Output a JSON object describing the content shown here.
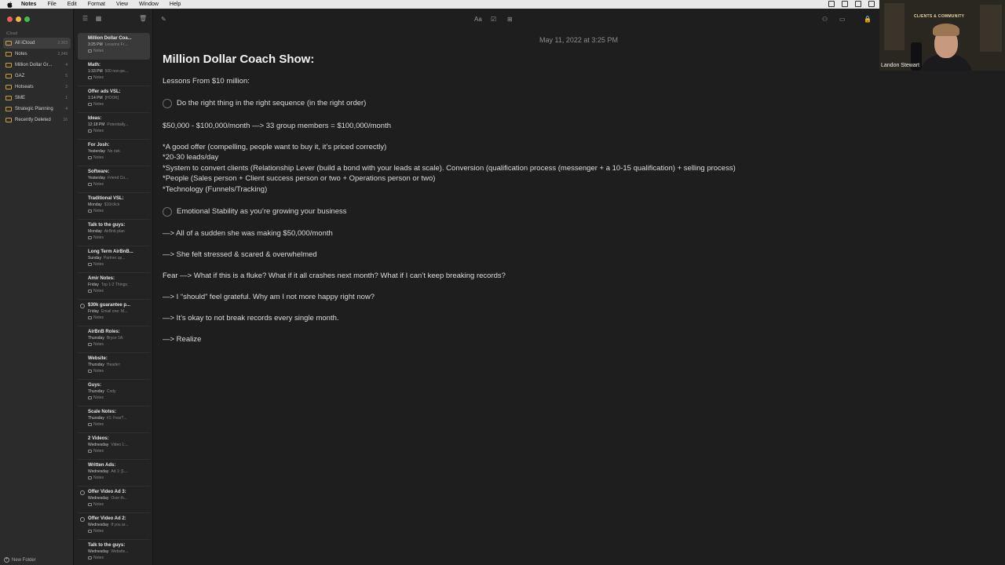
{
  "menubar": {
    "app_name": "Notes",
    "items": [
      "File",
      "Edit",
      "Format",
      "View",
      "Window",
      "Help"
    ]
  },
  "sidebar": {
    "section_label": "iCloud",
    "folders": [
      {
        "name": "All iCloud",
        "count": "2,363",
        "selected": true
      },
      {
        "name": "Notes",
        "count": "2,349"
      },
      {
        "name": "Million Dollar Gr...",
        "count": "4"
      },
      {
        "name": "GAZ",
        "count": "5"
      },
      {
        "name": "Hotseats",
        "count": "2"
      },
      {
        "name": "SME",
        "count": "1"
      },
      {
        "name": "Strategic Planning",
        "count": "4"
      },
      {
        "name": "Recently Deleted",
        "count": "16"
      }
    ],
    "new_folder_label": "New Folder"
  },
  "notes_list": [
    {
      "title": "Million Dollar Coa...",
      "time": "3:25 PM",
      "preview": "Lessons Fr...",
      "folder": "Notes",
      "selected": true
    },
    {
      "title": "Math:",
      "time": "1:33 PM",
      "preview": "500 non-pe...",
      "folder": "Notes"
    },
    {
      "title": "Offer ads VSL:",
      "time": "1:14 PM",
      "preview": "[HOOK]",
      "folder": "Notes"
    },
    {
      "title": "Ideas:",
      "time": "12:18 PM",
      "preview": "Potentially...",
      "folder": "Notes"
    },
    {
      "title": "For Josh:",
      "time": "Yesterday",
      "preview": "No risk.",
      "folder": "Notes"
    },
    {
      "title": "Software:",
      "time": "Yesterday",
      "preview": "Friend Co...",
      "folder": "Notes"
    },
    {
      "title": "Traditional VSL:",
      "time": "Monday",
      "preview": "$10/click",
      "folder": "Notes"
    },
    {
      "title": "Talk to the guys:",
      "time": "Monday",
      "preview": "AirBnb plan",
      "folder": "Notes"
    },
    {
      "title": "Long Term AirBnB...",
      "time": "Sunday",
      "preview": "Partner up...",
      "folder": "Notes"
    },
    {
      "title": "Amir Notes:",
      "time": "Friday",
      "preview": "Top 1-2 Things:",
      "folder": "Notes"
    },
    {
      "title": "$30k guarantee p...",
      "time": "Friday",
      "preview": "Email one: M...",
      "folder": "Notes",
      "shared": true
    },
    {
      "title": "AirBnB Roles:",
      "time": "Thursday",
      "preview": "Bryce 1A:",
      "folder": "Notes"
    },
    {
      "title": "Website:",
      "time": "Thursday",
      "preview": "Header:",
      "folder": "Notes"
    },
    {
      "title": "Guys:",
      "time": "Thursday",
      "preview": "Cody",
      "folder": "Notes"
    },
    {
      "title": "Scale Notes:",
      "time": "Thursday",
      "preview": "#1: Fear?...",
      "folder": "Notes"
    },
    {
      "title": "2 Videos:",
      "time": "Wednesday",
      "preview": "Video 1:...",
      "folder": "Notes"
    },
    {
      "title": "Written Ads:",
      "time": "Wednesday",
      "preview": "Ad 1: [L...",
      "folder": "Notes"
    },
    {
      "title": "Offer Video Ad 3:",
      "time": "Wednesday",
      "preview": "Over th...",
      "folder": "Notes",
      "shared": true
    },
    {
      "title": "Offer Video Ad 2:",
      "time": "Wednesday",
      "preview": "If you ar...",
      "folder": "Notes",
      "shared": true
    },
    {
      "title": "Talk to the guys:",
      "time": "Wednesday",
      "preview": "Website...",
      "folder": "Notes"
    }
  ],
  "editor": {
    "date": "May 11, 2022 at 3:25 PM",
    "title": "Million Dollar Coach Show:",
    "lessons_heading": "Lessons From $10 million:",
    "check1": "Do the right thing in the right sequence (in the right order)",
    "math_line": "$50,000 - $100,000/month —> 33 group members = $100,000/month",
    "bullets": [
      "*A good offer (compelling, people want to buy it, it’s priced correctly)",
      "*20-30 leads/day",
      "*System to convert clients (Relationship Lever (build a bond with your leads at scale). Conversion (qualification process (messenger + a 10-15 qualification) + selling process)",
      "*People (Sales person + Client success person or two + Operations person or two)",
      "*Technology (Funnels/Tracking)"
    ],
    "check2": "Emotional Stability as you’re growing your business",
    "lines": [
      "—> All of a sudden she was making $50,000/month",
      "—> She felt stressed & scared & overwhelmed",
      "Fear —> What if this is a fluke? What if it all crashes next month? What if I can’t keep breaking records?",
      "—> I “should” feel grateful. Why am I not more happy right now?",
      "—> It’s okay to not break records every single month.",
      "—> Realize"
    ],
    "toolbar": {
      "format_label": "Aa"
    }
  },
  "webcam": {
    "name": "Landon Stewart",
    "sign_text": "CLIENTS & COMMUNITY"
  },
  "colors": {
    "close": "#ee5c55",
    "minimize": "#f3b73f",
    "zoom": "#3fbf4a",
    "folder_accent": "#c9a23a"
  }
}
